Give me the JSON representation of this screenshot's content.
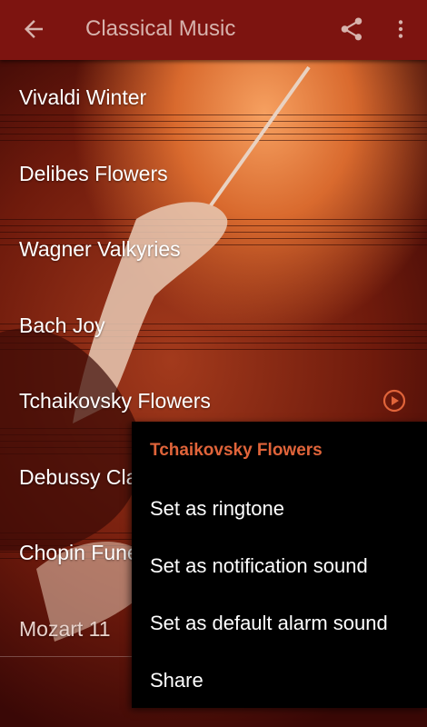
{
  "appbar": {
    "title": "Classical Music",
    "back_icon": "arrow-back-icon",
    "share_icon": "share-icon",
    "more_icon": "more-vert-icon",
    "color": "#7d1410"
  },
  "songs": [
    {
      "title": "Vivaldi Winter"
    },
    {
      "title": "Delibes Flowers"
    },
    {
      "title": "Wagner Valkyries"
    },
    {
      "title": "Bach Joy"
    },
    {
      "title": "Tchaikovsky Flowers",
      "play_icon": "play-circle-icon"
    },
    {
      "title": "Debussy Clair de Lune"
    },
    {
      "title": "Chopin Funeral March"
    },
    {
      "title": "Mozart 11"
    }
  ],
  "context_menu": {
    "header": "Tchaikovsky Flowers",
    "items": [
      {
        "label": "Set as ringtone"
      },
      {
        "label": "Set as notification sound"
      },
      {
        "label": "Set as default alarm sound"
      },
      {
        "label": "Share"
      }
    ],
    "accent": "#e0643a"
  }
}
